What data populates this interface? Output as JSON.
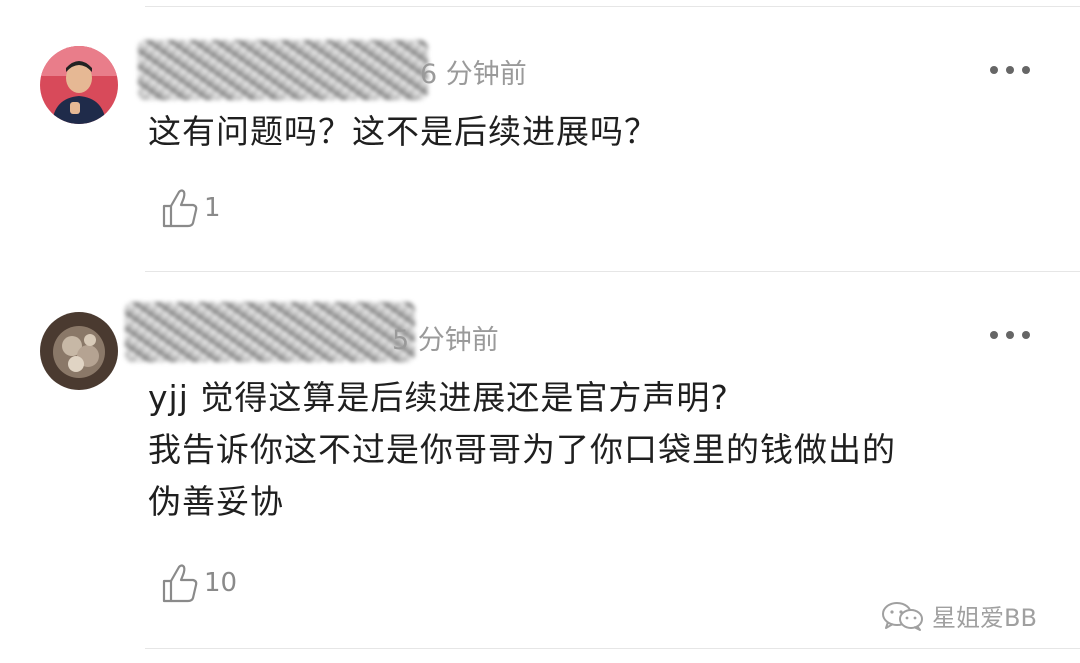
{
  "comments": [
    {
      "time": "6 分钟前",
      "text": "这有问题吗？这不是后续进展吗？",
      "likes": "1"
    },
    {
      "time": "5 分钟前",
      "text": "yjj 觉得这算是后续进展还是官方声明?\n我告诉你这不过是你哥哥为了你口袋里的钱做出的\n伪善妥协",
      "likes": "10"
    }
  ],
  "watermark": {
    "text": "星姐爱BB"
  }
}
